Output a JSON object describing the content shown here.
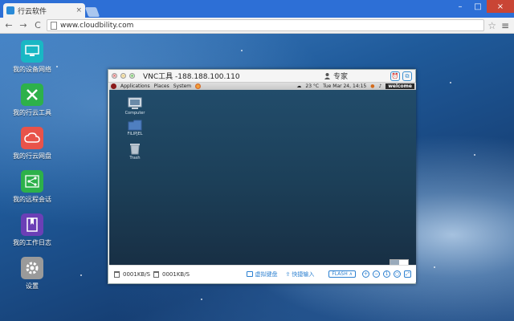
{
  "browser": {
    "tab_title": "行云软件",
    "tab_close": "×",
    "url": "www.cloudbility.com",
    "window_buttons": [
      "–",
      "□",
      "×"
    ],
    "nav": {
      "back": "←",
      "forward": "→",
      "reload": "C"
    },
    "star": "☆",
    "menu": "≡"
  },
  "desktop": {
    "icons": [
      {
        "label": "我的设备网络",
        "icon": "monitor-icon",
        "color": "#19b7c4"
      },
      {
        "label": "我的行云工具",
        "icon": "tools-icon",
        "color": "#2db14a"
      },
      {
        "label": "我的行云网盘",
        "icon": "cloud-icon",
        "color": "#e8534a"
      },
      {
        "label": "我的远程会话",
        "icon": "share-icon",
        "color": "#2db14a"
      },
      {
        "label": "我的工作日志",
        "icon": "book-icon",
        "color": "#6b3fb6"
      },
      {
        "label": "设置",
        "icon": "gear-icon",
        "color": "#9a9a9a"
      }
    ]
  },
  "vnc": {
    "title": "VNC工具 -188.188.100.110",
    "expert_label": "专家",
    "panel": {
      "menus": [
        "Applications",
        "Places",
        "System"
      ],
      "temperature": "23 °C",
      "datetime": "Tue Mar 24, 14:15",
      "welcome": "welcome"
    },
    "remote_icons": [
      {
        "label": "Computer",
        "icon": "computer-icon"
      },
      {
        "label": "FILIPJEL",
        "icon": "folder-icon"
      },
      {
        "label": "Trash",
        "icon": "trash-icon"
      }
    ],
    "footer": {
      "upload_speed": "0001KB/S",
      "download_speed": "0001KB/S",
      "virtual_keyboard": "虚拟键盘",
      "quick_input": "快捷输入",
      "flash": "FLASH ∧"
    }
  }
}
